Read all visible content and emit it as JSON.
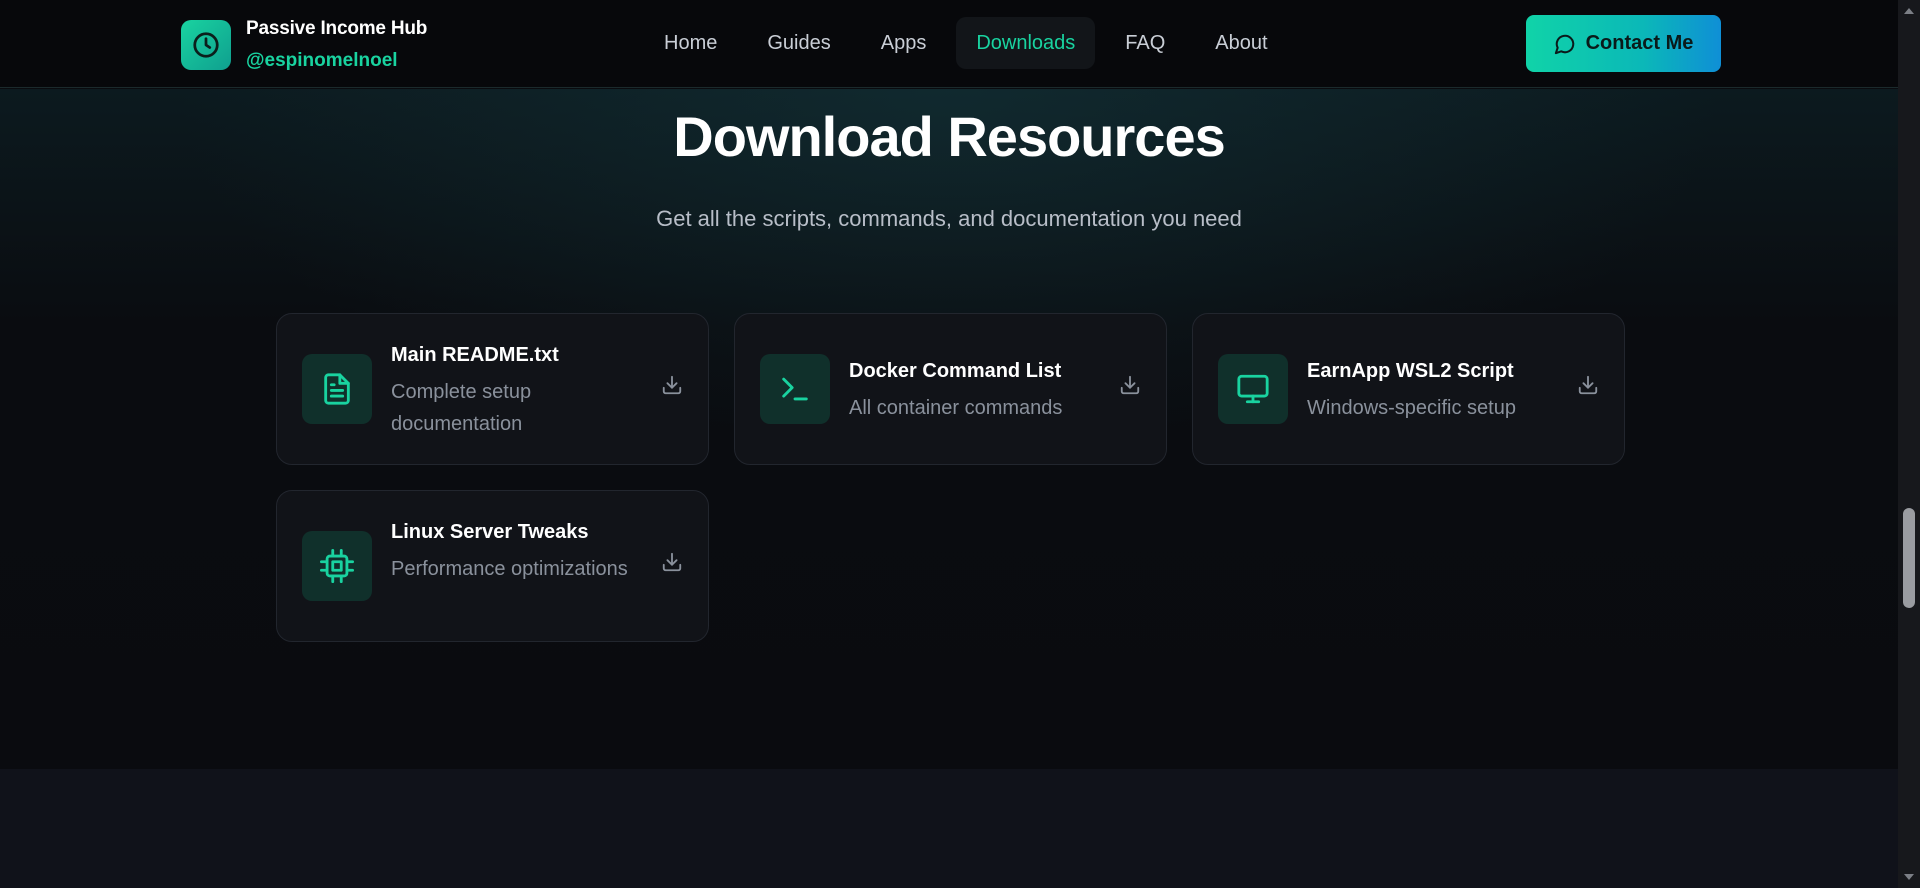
{
  "brand": {
    "title": "Passive Income Hub",
    "handle": "@espinomelnoel",
    "logo_icon": "clock-icon"
  },
  "nav": {
    "items": [
      {
        "label": "Home",
        "active": false
      },
      {
        "label": "Guides",
        "active": false
      },
      {
        "label": "Apps",
        "active": false
      },
      {
        "label": "Downloads",
        "active": true
      },
      {
        "label": "FAQ",
        "active": false
      },
      {
        "label": "About",
        "active": false
      }
    ]
  },
  "contact": {
    "label": "Contact Me",
    "icon": "chat-bubble-icon"
  },
  "main": {
    "title": "Download Resources",
    "subtitle": "Get all the scripts, commands, and documentation you need"
  },
  "resources": [
    {
      "title": "Main README.txt",
      "description": "Complete setup documentation",
      "icon": "document-icon"
    },
    {
      "title": "Docker Command List",
      "description": "All container commands",
      "icon": "terminal-icon"
    },
    {
      "title": "EarnApp WSL2 Script",
      "description": "Windows-specific setup",
      "icon": "monitor-icon"
    },
    {
      "title": "Linux Server Tweaks",
      "description": "Performance optimizations",
      "icon": "cpu-chip-icon"
    }
  ],
  "colors": {
    "accent": "#19d3a0",
    "background": "#0a0b0f",
    "card": "#111318",
    "button_gradient_start": "#10d3a8",
    "button_gradient_end": "#0f8fd6"
  }
}
